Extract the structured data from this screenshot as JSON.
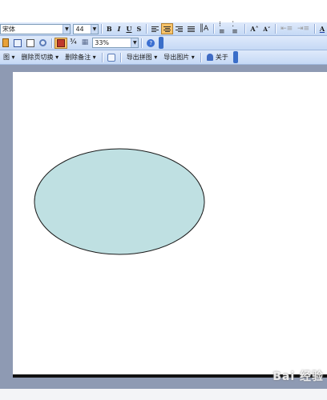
{
  "toolbar_format": {
    "font_name": "宋体",
    "font_size": "44",
    "bold": "B",
    "italic": "I",
    "underline": "U",
    "shadow": "S",
    "font_larger": "A˄",
    "font_smaller": "A˅",
    "font_color": "A"
  },
  "toolbar_standard": {
    "zoom": "33%"
  },
  "toolbar_addin": {
    "items": [
      {
        "label": "图 ▾"
      },
      {
        "label": "删除页切换 ▾"
      },
      {
        "label": "删除备注 ▾"
      },
      {
        "label": "导出拼图 ▾"
      },
      {
        "label": "导出图片 ▾"
      },
      {
        "label": "关于"
      }
    ]
  },
  "slide": {
    "shape_fill": "#bfe0e2",
    "shape_stroke": "#1a1a1a"
  },
  "watermark": "Bai 经验"
}
